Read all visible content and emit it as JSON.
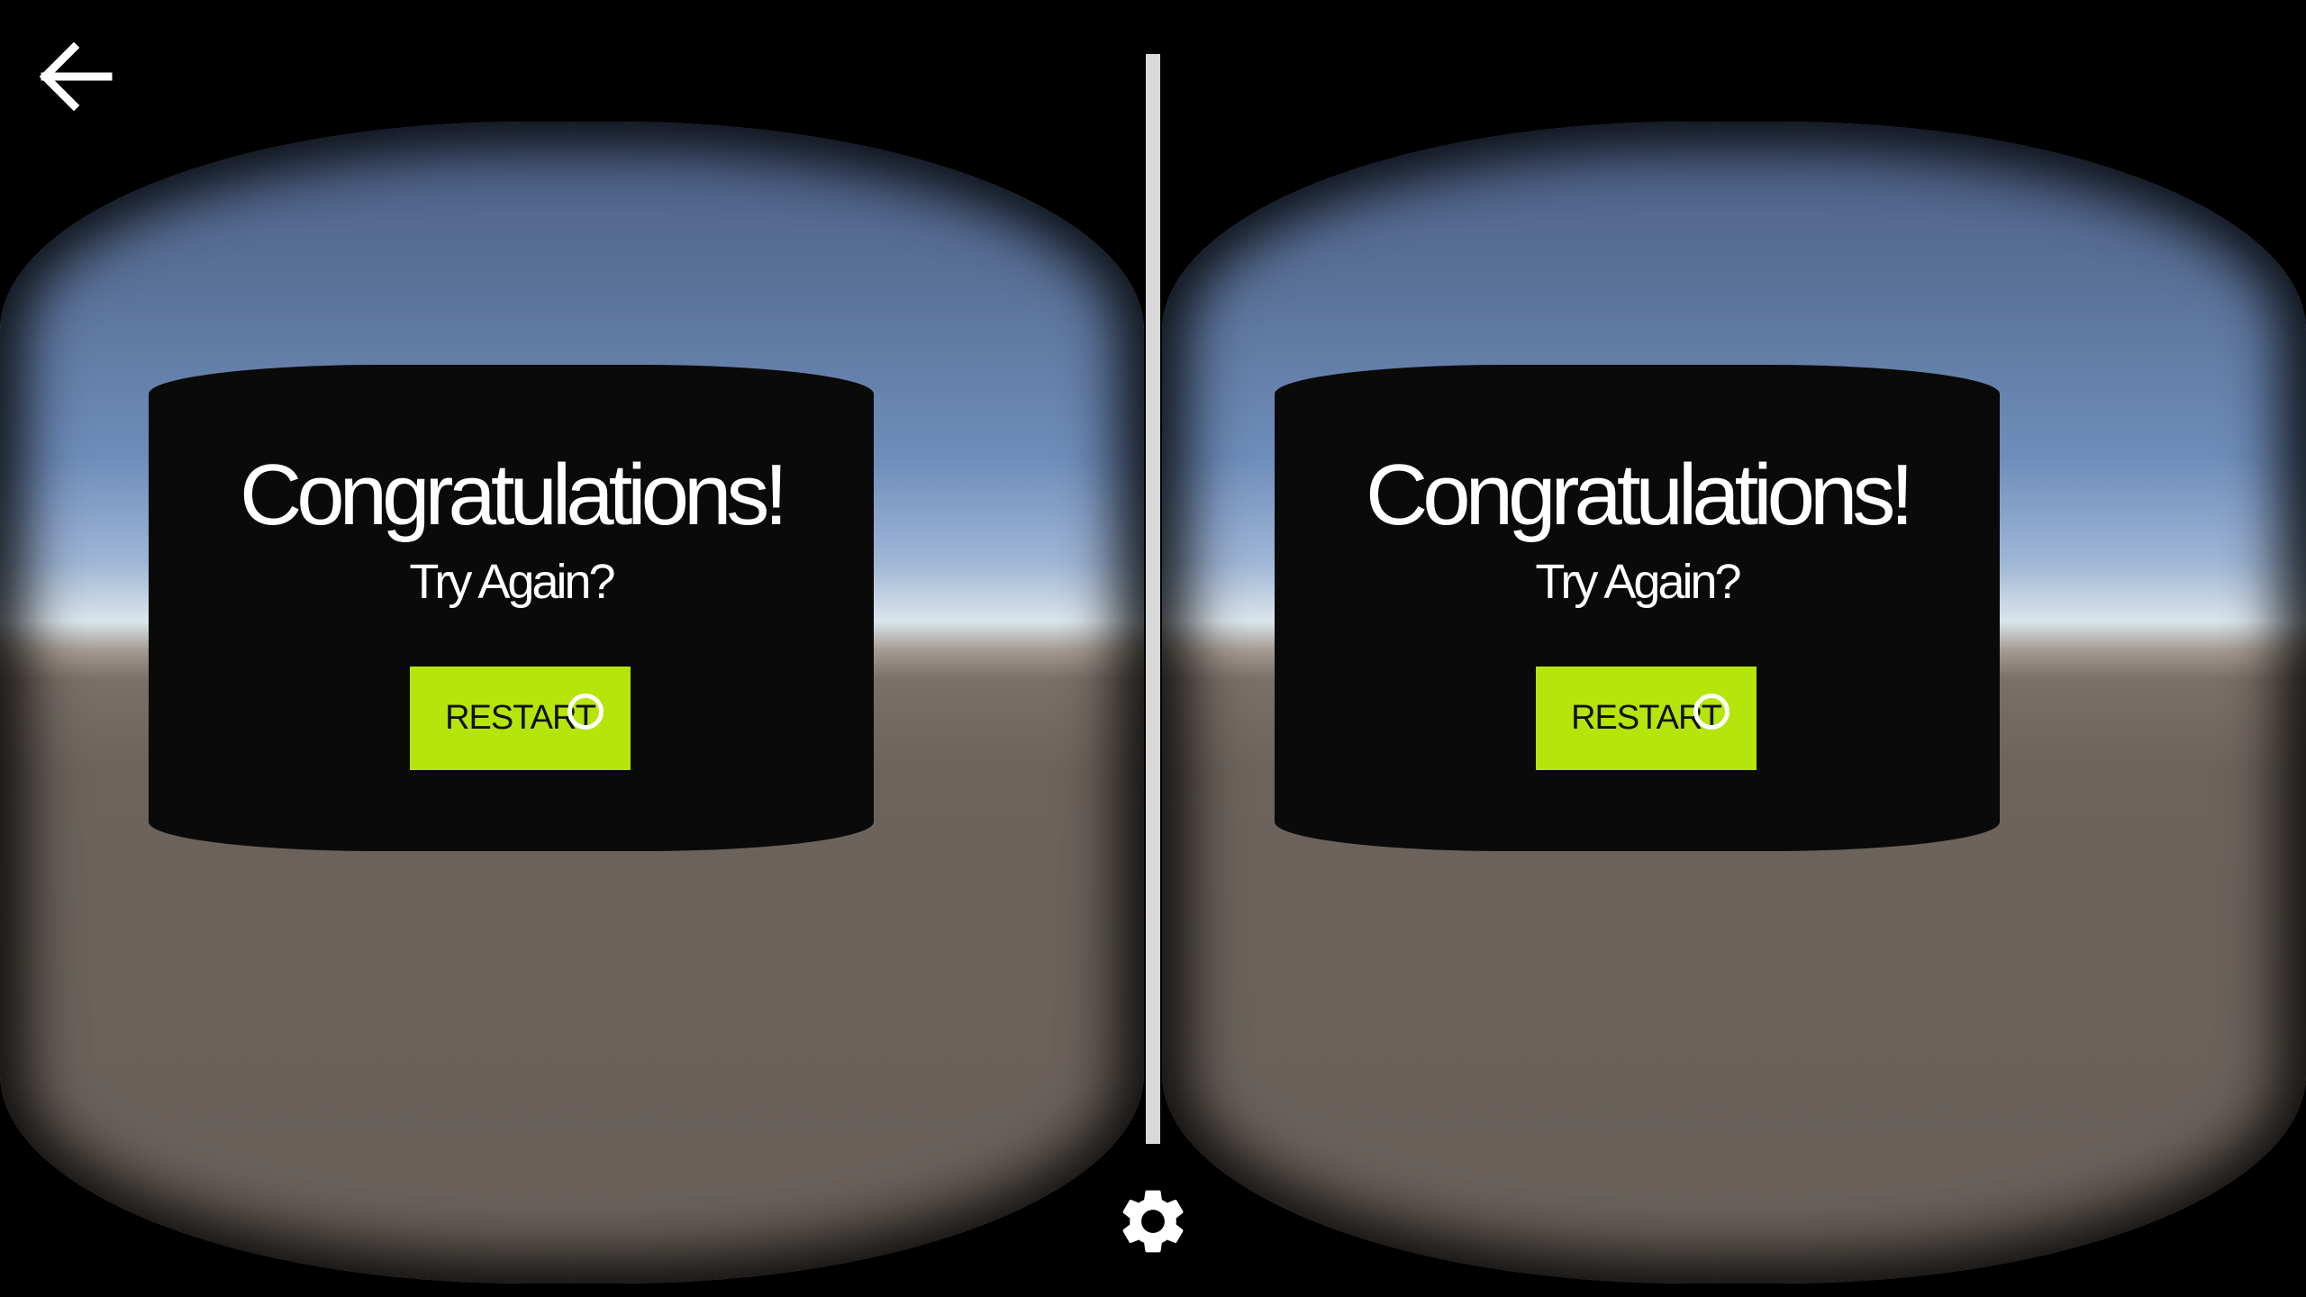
{
  "app": {
    "back_icon": "arrow-left-icon",
    "settings_icon": "gear-icon"
  },
  "dialog": {
    "title": "Congratulations!",
    "subtitle": "Try Again?",
    "button_label": "RESTART"
  },
  "colors": {
    "button": "#b5e50a",
    "panel": "#0a0a0a",
    "divider": "#d8d8d8"
  }
}
